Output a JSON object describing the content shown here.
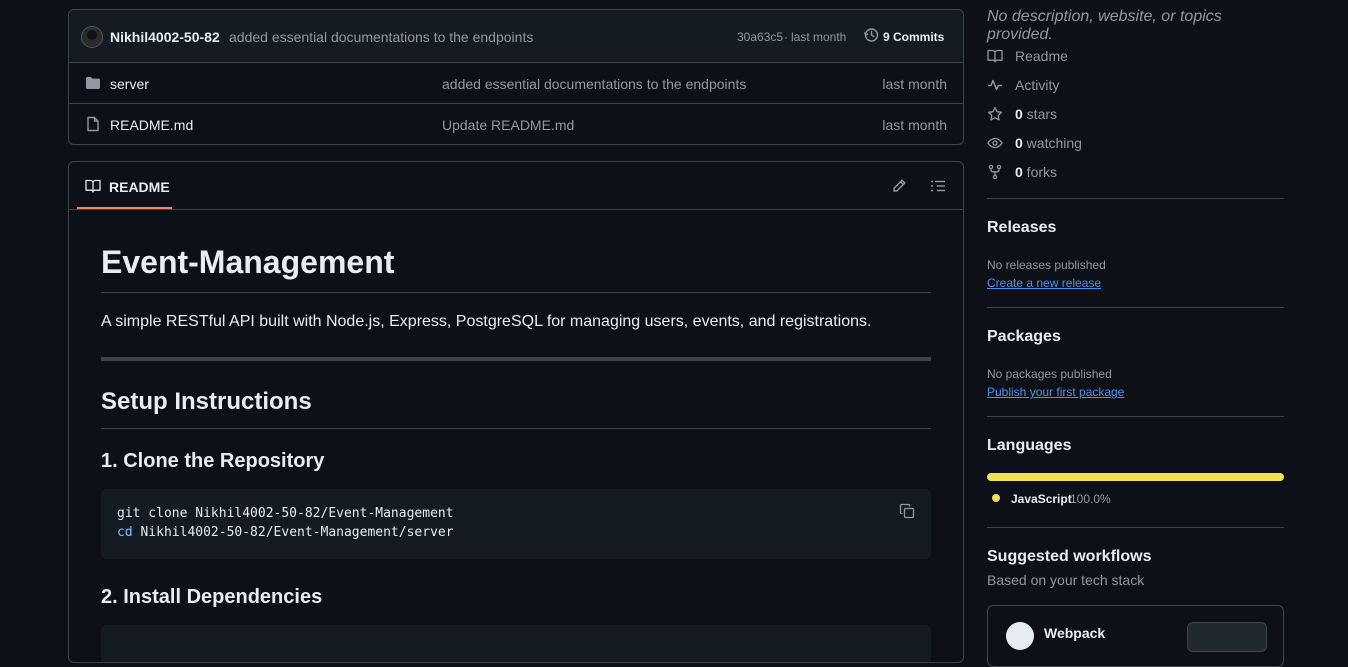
{
  "latest_commit": {
    "author": "Nikhil4002-50-82",
    "message": "added essential documentations to the endpoints",
    "hash": "30a63c5",
    "separator": "·",
    "when": "last month",
    "commits_label": "9 Commits"
  },
  "files": [
    {
      "icon": "folder-icon",
      "name": "server",
      "message": "added essential documentations to the endpoints",
      "when": "last month"
    },
    {
      "icon": "file-icon",
      "name": "README.md",
      "message": "Update README.md",
      "when": "last month"
    }
  ],
  "readme": {
    "tab_label": "README",
    "title": "Event-Management",
    "description": "A simple RESTful API built with Node.js, Express, PostgreSQL for managing users, events, and registrations.",
    "h2_setup": "Setup Instructions",
    "h3_clone": "1. Clone the Repository",
    "code_line1": "git clone Nikhil4002-50-82/Event-Management",
    "code_line2_kw": "cd",
    "code_line2_rest": " Nikhil4002-50-82/Event-Management/server",
    "h3_install": "2. Install Dependencies"
  },
  "sidebar": {
    "about": "No description, website, or topics provided.",
    "readme": "Readme",
    "activity": "Activity",
    "stars_count": "0",
    "stars_label": " stars",
    "watching_count": "0",
    "watching_label": " watching",
    "forks_count": "0",
    "forks_label": " forks",
    "releases_title": "Releases",
    "releases_none": "No releases published",
    "releases_link": "Create a new release",
    "packages_title": "Packages",
    "packages_none": "No packages published",
    "packages_link": "Publish your first package",
    "languages_title": "Languages",
    "language_name": "JavaScript",
    "language_pct": "100.0%",
    "language_fraction": 1.0,
    "language_color": "#f1e05a",
    "workflows_title": "Suggested workflows",
    "workflows_sub": "Based on your tech stack",
    "workflow_name": "Webpack"
  },
  "colors": {
    "accent_tab": "#f78166",
    "link": "#4493f8",
    "bg": "#0d1117"
  }
}
